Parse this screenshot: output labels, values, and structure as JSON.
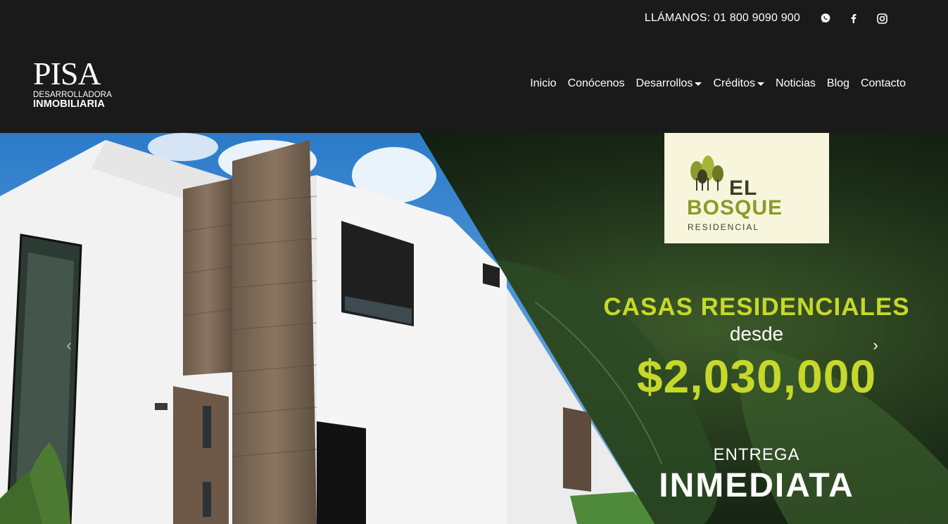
{
  "topbar": {
    "phone": "LLÁMANOS: 01 800 9090 900",
    "social": [
      "whatsapp-icon",
      "facebook-icon",
      "instagram-icon"
    ]
  },
  "logo": {
    "mark": "PISA",
    "line1": "DESARROLLADORA",
    "line2": "INMOBILIARIA"
  },
  "nav": {
    "items": [
      {
        "label": "Inicio"
      },
      {
        "label": "Conócenos"
      },
      {
        "label": "Desarrollos"
      },
      {
        "label": "Créditos"
      },
      {
        "label": "Noticias"
      },
      {
        "label": "Blog"
      },
      {
        "label": "Contacto"
      }
    ]
  },
  "hero": {
    "badge": {
      "line1": "EL",
      "line2": "BOSQUE",
      "line3": "RESIDENCIAL"
    },
    "headline": "CASAS RESIDENCIALES",
    "from": "desde",
    "price": "$2,030,000",
    "delivery": "ENTREGA",
    "delivery_strong": "INMEDIATA",
    "prev_arrow": "‹",
    "next_arrow": "›"
  },
  "colors": {
    "header_bg": "#1a1a1a",
    "accent_green": "#c6d82a",
    "badge_bg": "#f7f6dd"
  }
}
